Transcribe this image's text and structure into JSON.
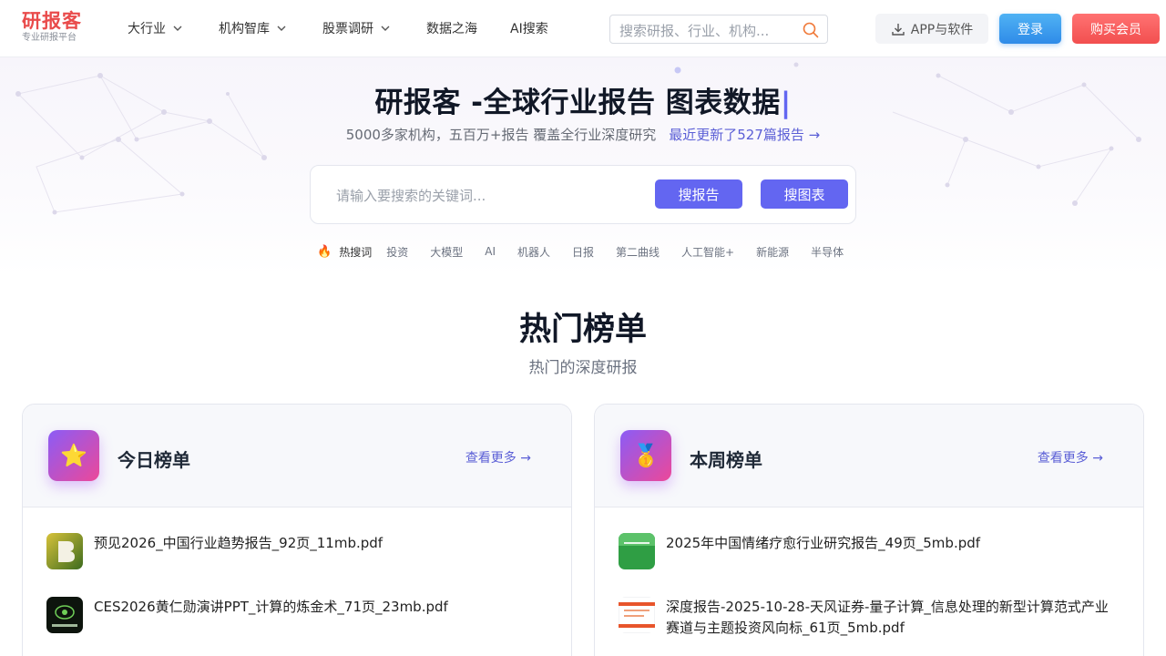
{
  "header": {
    "logo_title": "研报客",
    "logo_subtitle": "专业研报平台",
    "nav": [
      {
        "label": "大行业",
        "dropdown": true
      },
      {
        "label": "机构智库",
        "dropdown": true
      },
      {
        "label": "股票调研",
        "dropdown": true
      },
      {
        "label": "数据之海",
        "dropdown": false
      },
      {
        "label": "AI搜索",
        "dropdown": false
      }
    ],
    "search_placeholder": "搜索研报、行业、机构...",
    "app_button": "APP与软件",
    "login_button": "登录",
    "vip_button": "购买会员"
  },
  "hero": {
    "title": "研报客 -全球行业报告 图表数据",
    "cursor": "|",
    "subtitle": "5000多家机构，五百万+报告 覆盖全行业深度研究",
    "update_link": "最近更新了527篇报告 →",
    "search_placeholder": "请输入要搜索的关键词...",
    "search_report_button": "搜报告",
    "search_chart_button": "搜图表",
    "hot_label": "热搜词",
    "hot_words": [
      "投资",
      "大模型",
      "AI",
      "机器人",
      "日报",
      "第二曲线",
      "人工智能+",
      "新能源",
      "半导体"
    ]
  },
  "section": {
    "title": "热门榜单",
    "subtitle": "热门的深度研报"
  },
  "cards": [
    {
      "title": "今日榜单",
      "icon": "star-icon",
      "icon_glyph": "⭐",
      "more": "查看更多 →",
      "items": [
        {
          "title": "预见2026_中国行业趋势报告_92页_11mb.pdf"
        },
        {
          "title": "CES2026黄仁勋演讲PPT_计算的炼金术_71页_23mb.pdf"
        }
      ]
    },
    {
      "title": "本周榜单",
      "icon": "medal-icon",
      "icon_glyph": "🥇",
      "more": "查看更多 →",
      "items": [
        {
          "title": "2025年中国情绪疗愈行业研究报告_49页_5mb.pdf"
        },
        {
          "title": "深度报告-2025-10-28-天风证券-量子计算_信息处理的新型计算范式产业赛道与主题投资风向标_61页_5mb.pdf"
        }
      ]
    }
  ],
  "colors": {
    "accent": "#6366f1",
    "logo": "#e94b4b",
    "login": "#2f8be8",
    "vip": "#f24f4f"
  }
}
